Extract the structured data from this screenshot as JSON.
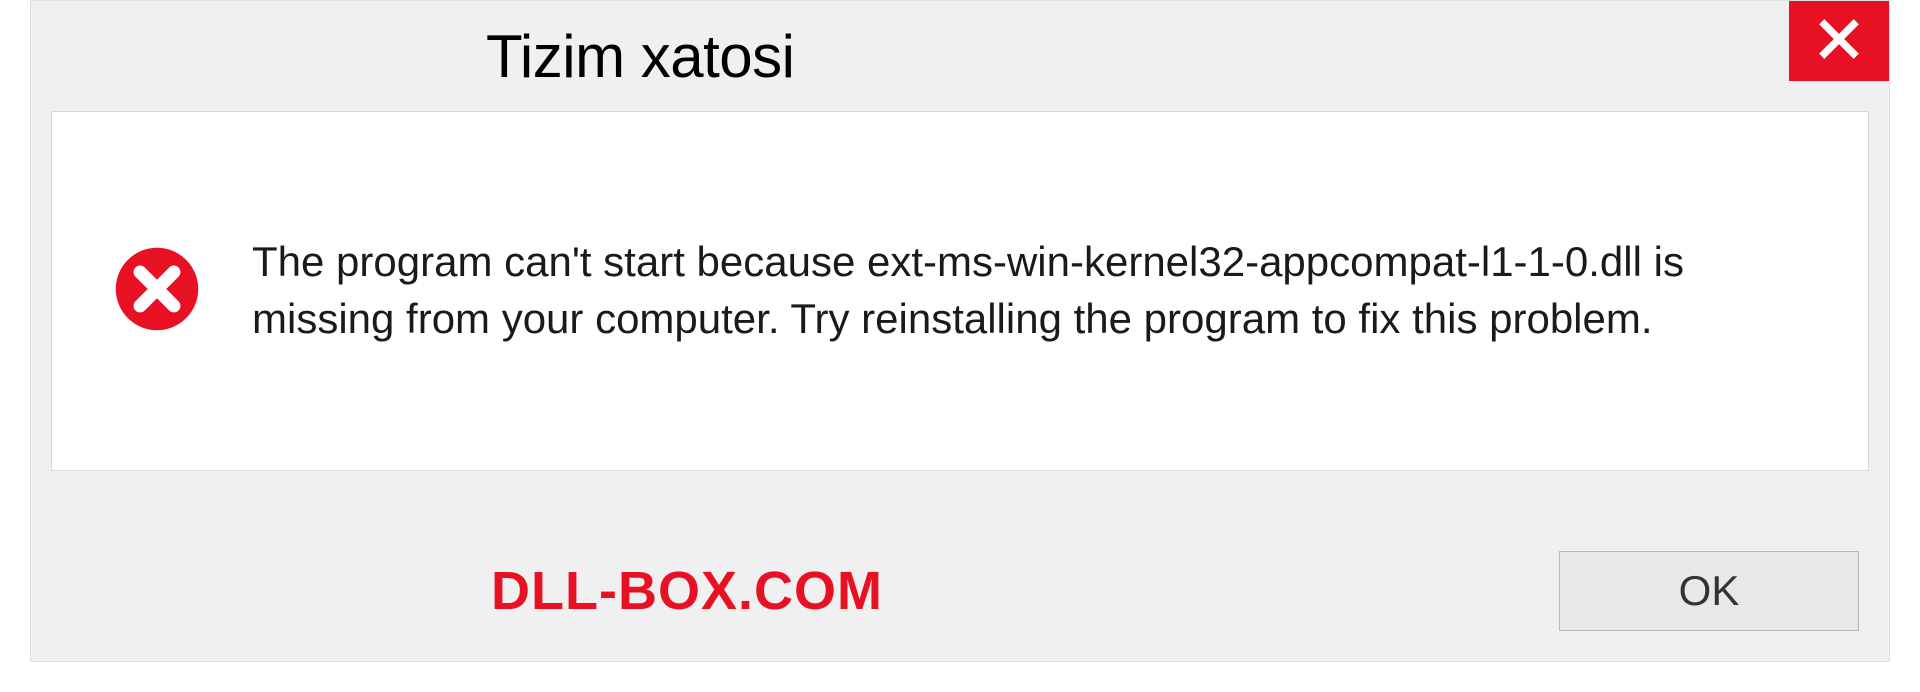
{
  "dialog": {
    "title": "Tizim xatosi",
    "message": "The program can't start because ext-ms-win-kernel32-appcompat-l1-1-0.dll is missing from your computer. Try reinstalling the program to fix this problem.",
    "ok_label": "OK"
  },
  "watermark": "DLL-BOX.COM",
  "colors": {
    "accent_red": "#e81123",
    "panel_bg": "#f0f0f0",
    "content_bg": "#ffffff"
  },
  "icons": {
    "close": "close-x",
    "error": "error-circle-x"
  }
}
